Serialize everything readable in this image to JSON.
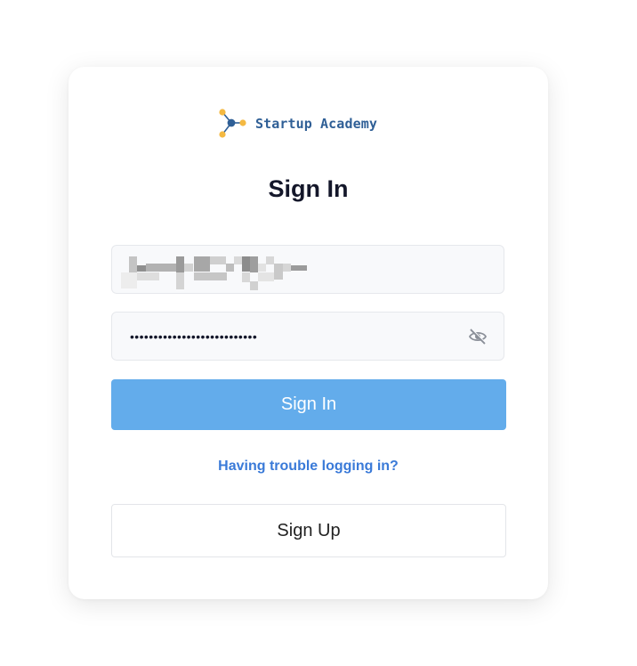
{
  "brand": {
    "name": "Startup Academy",
    "logo_icon": "molecule-logo-icon",
    "colors": {
      "node_primary": "#2f5f96",
      "node_accent": "#f4b942",
      "text": "#2f5f96"
    }
  },
  "form": {
    "title": "Sign In",
    "email": {
      "value_masked": true,
      "note": ""
    },
    "password": {
      "value": "•••••••••••••••••••••••••••",
      "toggle_icon": "eye-off-icon"
    },
    "submit_label": "Sign In",
    "trouble_link": "Having trouble logging in?",
    "signup_label": "Sign Up"
  },
  "colors": {
    "primary_button": "#63aceb",
    "link": "#3a7ad8",
    "title": "#14172a"
  }
}
